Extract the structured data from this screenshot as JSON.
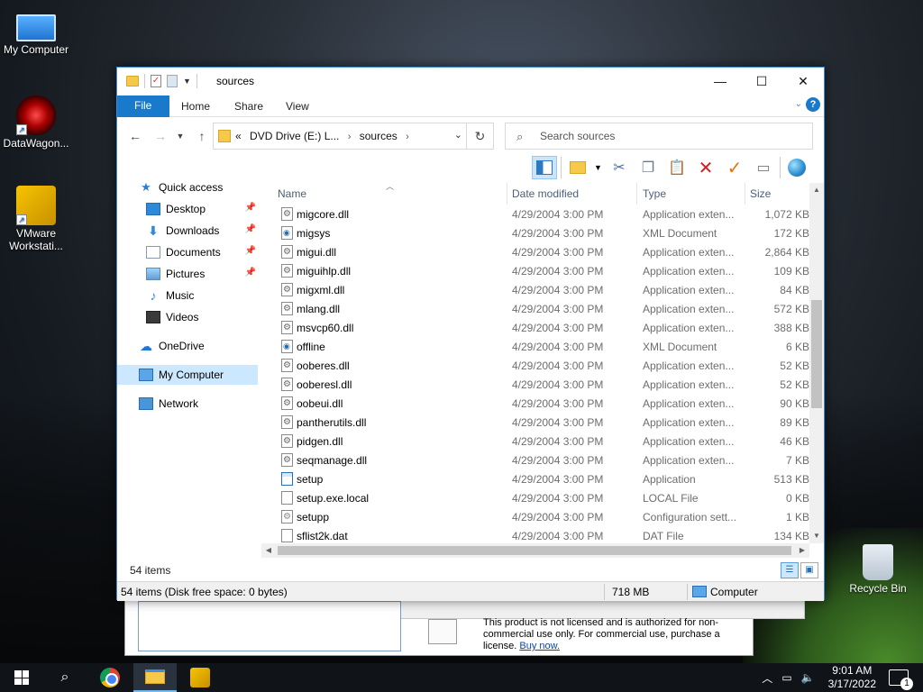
{
  "desktop": {
    "icons": [
      {
        "label": "My Computer"
      },
      {
        "label": "DataWagon..."
      },
      {
        "label": "VMware Workstati..."
      },
      {
        "label": "Recycle Bin"
      }
    ]
  },
  "background_dialog": {
    "license_text": "This product is not licensed and is authorized for non-commercial use only. For commercial use, purchase a license.",
    "buy_link": "Buy now."
  },
  "window": {
    "title": "sources",
    "controls": {
      "minimize": "—",
      "maximize": "☐",
      "close": "✕"
    },
    "ribbon": {
      "tabs": [
        "File",
        "Home",
        "Share",
        "View"
      ],
      "help": "?"
    },
    "address": {
      "overflow": "«",
      "crumbs": [
        "DVD Drive (E:) L...",
        "sources"
      ]
    },
    "search": {
      "placeholder": "Search sources"
    },
    "nav_pane": {
      "items": [
        {
          "label": "Quick access"
        },
        {
          "label": "Desktop"
        },
        {
          "label": "Downloads"
        },
        {
          "label": "Documents"
        },
        {
          "label": "Pictures"
        },
        {
          "label": "Music"
        },
        {
          "label": "Videos"
        },
        {
          "label": "OneDrive"
        },
        {
          "label": "My Computer"
        },
        {
          "label": "Network"
        }
      ]
    },
    "columns": {
      "name": "Name",
      "date": "Date modified",
      "type": "Type",
      "size": "Size"
    },
    "files": [
      {
        "name": "migcore.dll",
        "date": "4/29/2004 3:00 PM",
        "type": "Application exten...",
        "size": "1,072 KB",
        "icon": "dll"
      },
      {
        "name": "migsys",
        "date": "4/29/2004 3:00 PM",
        "type": "XML Document",
        "size": "172 KB",
        "icon": "xml"
      },
      {
        "name": "migui.dll",
        "date": "4/29/2004 3:00 PM",
        "type": "Application exten...",
        "size": "2,864 KB",
        "icon": "dll"
      },
      {
        "name": "miguihlp.dll",
        "date": "4/29/2004 3:00 PM",
        "type": "Application exten...",
        "size": "109 KB",
        "icon": "dll"
      },
      {
        "name": "migxml.dll",
        "date": "4/29/2004 3:00 PM",
        "type": "Application exten...",
        "size": "84 KB",
        "icon": "dll"
      },
      {
        "name": "mlang.dll",
        "date": "4/29/2004 3:00 PM",
        "type": "Application exten...",
        "size": "572 KB",
        "icon": "dll"
      },
      {
        "name": "msvcp60.dll",
        "date": "4/29/2004 3:00 PM",
        "type": "Application exten...",
        "size": "388 KB",
        "icon": "dll"
      },
      {
        "name": "offline",
        "date": "4/29/2004 3:00 PM",
        "type": "XML Document",
        "size": "6 KB",
        "icon": "xml"
      },
      {
        "name": "ooberes.dll",
        "date": "4/29/2004 3:00 PM",
        "type": "Application exten...",
        "size": "52 KB",
        "icon": "dll"
      },
      {
        "name": "ooberesl.dll",
        "date": "4/29/2004 3:00 PM",
        "type": "Application exten...",
        "size": "52 KB",
        "icon": "dll"
      },
      {
        "name": "oobeui.dll",
        "date": "4/29/2004 3:00 PM",
        "type": "Application exten...",
        "size": "90 KB",
        "icon": "dll"
      },
      {
        "name": "pantherutils.dll",
        "date": "4/29/2004 3:00 PM",
        "type": "Application exten...",
        "size": "89 KB",
        "icon": "dll"
      },
      {
        "name": "pidgen.dll",
        "date": "4/29/2004 3:00 PM",
        "type": "Application exten...",
        "size": "46 KB",
        "icon": "dll"
      },
      {
        "name": "seqmanage.dll",
        "date": "4/29/2004 3:00 PM",
        "type": "Application exten...",
        "size": "7 KB",
        "icon": "dll"
      },
      {
        "name": "setup",
        "date": "4/29/2004 3:00 PM",
        "type": "Application",
        "size": "513 KB",
        "icon": "app"
      },
      {
        "name": "setup.exe.local",
        "date": "4/29/2004 3:00 PM",
        "type": "LOCAL File",
        "size": "0 KB",
        "icon": "file"
      },
      {
        "name": "setupp",
        "date": "4/29/2004 3:00 PM",
        "type": "Configuration sett...",
        "size": "1 KB",
        "icon": "cfg"
      },
      {
        "name": "sflist2k.dat",
        "date": "4/29/2004 3:00 PM",
        "type": "DAT File",
        "size": "134 KB",
        "icon": "file"
      }
    ],
    "status": {
      "item_count": "54 items",
      "detail": "54 items (Disk free space: 0 bytes)",
      "size": "718 MB",
      "location": "Computer"
    }
  },
  "taskbar": {
    "time": "9:01 AM",
    "date": "3/17/2022",
    "notifications": "1"
  },
  "colors": {
    "accent": "#1979ca",
    "selection": "#cce8ff"
  }
}
